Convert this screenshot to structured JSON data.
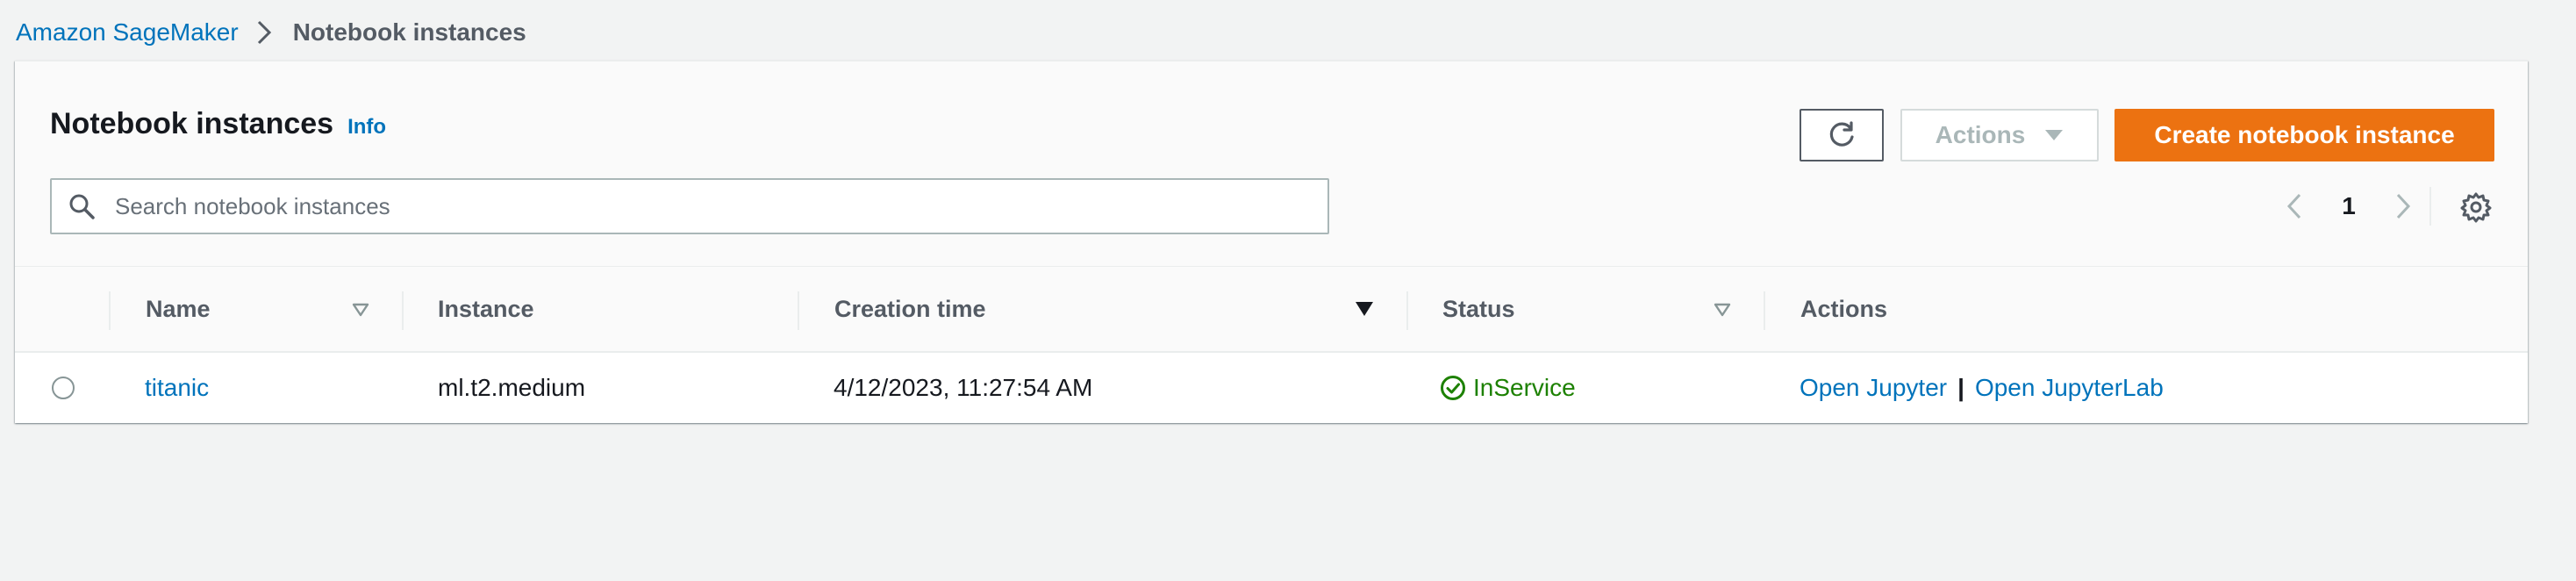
{
  "breadcrumb": {
    "root": "Amazon SageMaker",
    "current": "Notebook instances"
  },
  "panel": {
    "title": "Notebook instances",
    "info": "Info",
    "search": {
      "placeholder": "Search notebook instances",
      "value": ""
    },
    "buttons": {
      "actions": "Actions",
      "create": "Create notebook instance"
    },
    "pagination": {
      "page": "1"
    }
  },
  "table": {
    "columns": {
      "name": "Name",
      "instance": "Instance",
      "creation_time": "Creation time",
      "status": "Status",
      "actions": "Actions"
    },
    "rows": [
      {
        "name": "titanic",
        "instance": "ml.t2.medium",
        "creation_time": "4/12/2023, 11:27:54 AM",
        "status": "InService",
        "action_jupyter": "Open Jupyter",
        "action_separator": "|",
        "action_jupyterlab": "Open JupyterLab"
      }
    ]
  },
  "colors": {
    "link": "#0073bb",
    "primary_button": "#ec7211",
    "status_success": "#1d8102",
    "background": "#f2f3f3"
  },
  "icons": {
    "breadcrumb_separator": "chevron-right-icon",
    "search": "search-icon",
    "refresh": "refresh-icon",
    "actions_caret": "caret-down-icon",
    "page_prev": "chevron-left-icon",
    "page_next": "chevron-right-icon",
    "settings": "gear-icon",
    "sort_filter": "sort-triangle-icon",
    "sort_active": "sort-descending-icon",
    "status_ok": "check-circle-icon"
  }
}
